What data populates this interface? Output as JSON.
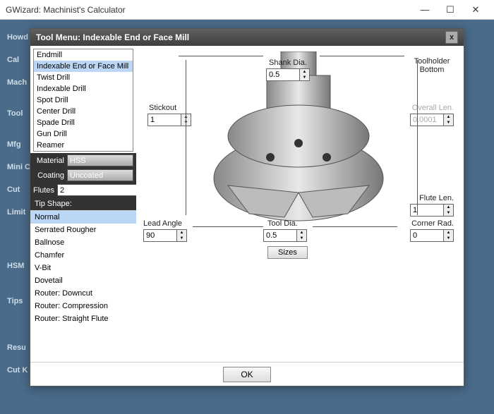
{
  "window": {
    "title": "GWizard: Machinist's Calculator"
  },
  "backdrop_labels": [
    "Howd",
    "Cal",
    "Mach",
    "Tool",
    "Mfg",
    "Mini Calc",
    "Cut",
    "Limit",
    "HSM",
    "Tips",
    "Resu",
    "Cut K"
  ],
  "dialog": {
    "title": "Tool Menu: Indexable End or Face Mill",
    "ok": "OK",
    "tool_types": {
      "items": [
        "Endmill",
        "Indexable End or Face Mill",
        "Twist Drill",
        "Indexable Drill",
        "Spot Drill",
        "Center Drill",
        "Spade Drill",
        "Gun Drill",
        "Reamer"
      ],
      "selected_index": 1
    },
    "material": {
      "label": "Material",
      "value": "HSS"
    },
    "coating": {
      "label": "Coating",
      "value": "Uncoated"
    },
    "flutes": {
      "label": "Flutes",
      "value": "2"
    },
    "tip_header": "Tip Shape:",
    "tip_shapes": {
      "items": [
        "Normal",
        "Serrated Rougher",
        "Ballnose",
        "Chamfer",
        "V-Bit",
        "Dovetail",
        "Router: Downcut",
        "Router: Compression",
        "Router: Straight Flute"
      ],
      "selected_index": 0
    },
    "fields": {
      "shank_dia": {
        "label": "Shank Dia.",
        "value": "0.5"
      },
      "toolholder": {
        "label": "Toolholder Bottom"
      },
      "stickout": {
        "label": "Stickout",
        "value": "1"
      },
      "overall_len": {
        "label": "Overall Len.",
        "value": "0.0001"
      },
      "lead_angle": {
        "label": "Lead Angle",
        "value": "90"
      },
      "tool_dia": {
        "label": "Tool Dia.",
        "value": "0.5"
      },
      "flute_len": {
        "label": "Flute Len.",
        "value": "1"
      },
      "corner_rad": {
        "label": "Corner Rad.",
        "value": "0"
      },
      "sizes_btn": "Sizes"
    }
  }
}
